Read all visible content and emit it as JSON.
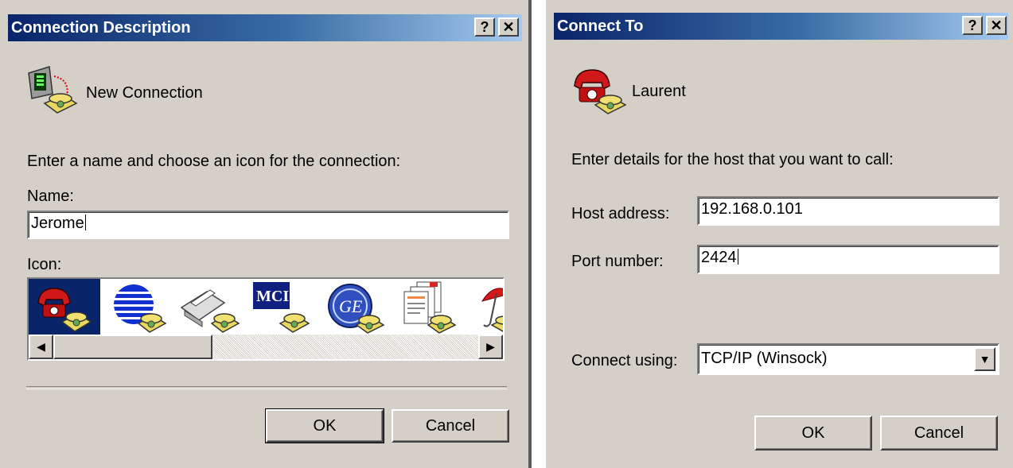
{
  "dialog1": {
    "title": "Connection Description",
    "help_label": "?",
    "close_label": "✕",
    "connection_name": "New Connection",
    "instruction": "Enter a name and choose an icon for the connection:",
    "name_label": "Name:",
    "name_value": "Jerome",
    "icon_label": "Icon:",
    "icons": [
      "red-phone-icon",
      "globe-phone-icon",
      "fax-phone-icon",
      "mci-phone-icon",
      "ge-phone-icon",
      "document-phone-icon",
      "umbrella-phone-icon"
    ],
    "selected_icon_index": 0,
    "ok_label": "OK",
    "cancel_label": "Cancel"
  },
  "dialog2": {
    "title": "Connect To",
    "help_label": "?",
    "close_label": "✕",
    "connection_name": "Laurent",
    "instruction": "Enter details for the host that you want to call:",
    "host_label": "Host address:",
    "host_value": "192.168.0.101",
    "port_label": "Port number:",
    "port_value": "2424",
    "connect_label": "Connect using:",
    "connect_value": "TCP/IP (Winsock)",
    "ok_label": "OK",
    "cancel_label": "Cancel"
  },
  "colors": {
    "titlebar_start": "#0a246a",
    "titlebar_end": "#a6caf0",
    "dialog_face": "#d4d0c8",
    "selection": "#0a246a"
  }
}
